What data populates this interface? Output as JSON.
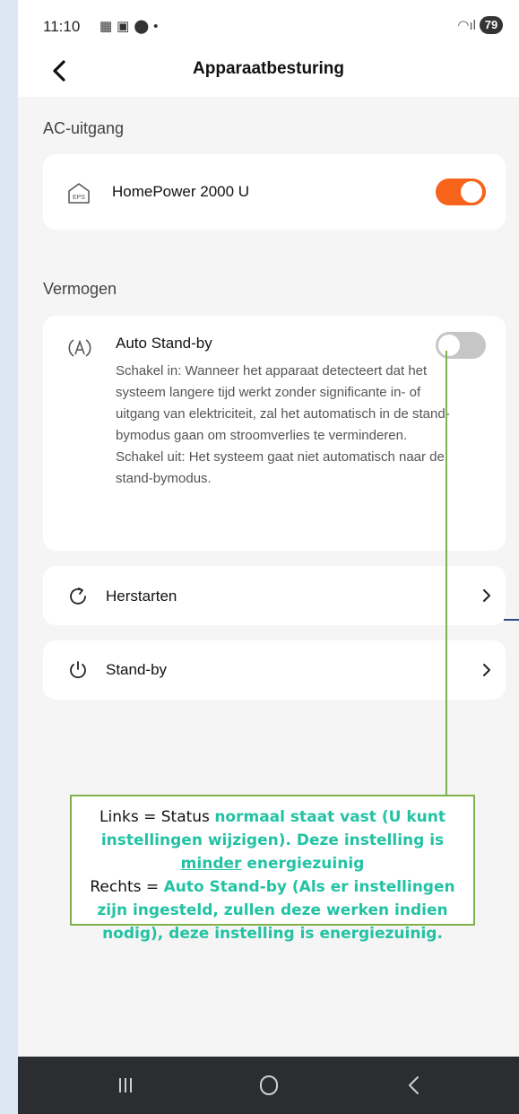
{
  "status_bar": {
    "time": "11:10",
    "battery": "79"
  },
  "header": {
    "title": "Apparaatbesturing"
  },
  "ac_section": {
    "label": "AC-uitgang",
    "device_name": "HomePower 2000 U",
    "device_icon_text": "EPS",
    "toggle_on": true
  },
  "power_section": {
    "label": "Vermogen",
    "auto_standby": {
      "title": "Auto Stand-by",
      "description_on": "Schakel in: Wanneer het apparaat detecteert dat het systeem langere tijd werkt zonder significante in- of uitgang van elektriciteit, zal het automatisch in de stand-bymodus gaan om stroomverlies te verminderen.",
      "description_off": "Schakel uit: Het systeem gaat niet automatisch naar de stand-bymodus.",
      "toggle_on": false
    },
    "restart_label": "Herstarten",
    "standby_label": "Stand-by"
  },
  "callout": {
    "l1_a": "Links = Status ",
    "l1_b": "normaal staat vast (U kunt instellingen wijzigen). Deze instelling is ",
    "l1_c": "minder",
    "l1_d": " energiezuinig",
    "l2_a": "Rechts = ",
    "l2_b": "Auto Stand-by (Als er instellingen zijn ingesteld, zullen deze werken indien nodig), deze instelling is energiezuinig."
  },
  "colors": {
    "accent": "#f7631b",
    "callout_border": "#7fb248",
    "callout_text": "#23c2a4"
  },
  "icons": [
    "back-icon",
    "eps-icon",
    "auto-a-icon",
    "restart-icon",
    "power-icon",
    "chevron-right-icon"
  ]
}
